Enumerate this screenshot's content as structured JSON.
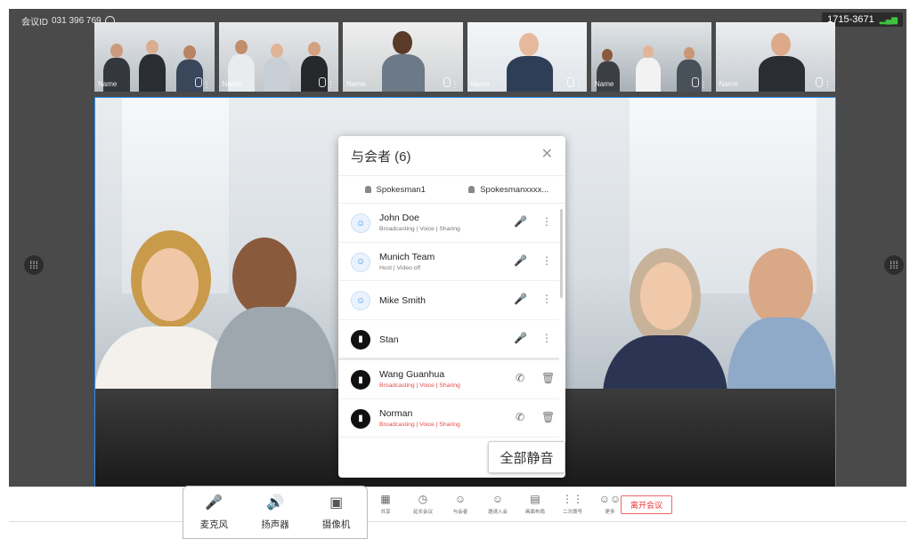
{
  "meeting": {
    "id_label": "会议ID",
    "id_value": "031 396 769",
    "room_code": "1715-3671",
    "signal_icon": "signal-icon"
  },
  "thumbnails": [
    {
      "name": "Name"
    },
    {
      "name": "Name"
    },
    {
      "name": "Name"
    },
    {
      "name": "Name"
    },
    {
      "name": "Name"
    },
    {
      "name": "Name"
    }
  ],
  "participants_panel": {
    "title": "与会者 (6)",
    "spokesmen": [
      "Spokesman1",
      "Spokesmanxxxx..."
    ],
    "participants": [
      {
        "name": "John Doe",
        "status": "Broadcasting | Voice | Sharing",
        "avatar": "person-icon"
      },
      {
        "name": "Munich Team",
        "status": "Host | Video off",
        "avatar": "person-icon"
      },
      {
        "name": "Mike Smith",
        "status": "",
        "avatar": "person-icon"
      },
      {
        "name": "Stan",
        "status": "",
        "avatar": "device-icon"
      },
      {
        "name": "Wang Guanhua",
        "status": "Broadcasting | Voice | Sharing",
        "avatar": "device-icon"
      },
      {
        "name": "Norman",
        "status": "Broadcasting | Voice | Sharing",
        "avatar": "device-icon"
      }
    ],
    "mute_all": "全部静音"
  },
  "toolbar": {
    "microphone": "麦克风",
    "speaker": "扬声器",
    "camera": "摄像机",
    "items": [
      "共享",
      "延长会议",
      "与会者",
      "邀请入会",
      "画面布局",
      "二次拨号",
      "更多"
    ],
    "leave": "离开会议"
  },
  "colors": {
    "accent": "#2a8ef1",
    "danger": "#e33333",
    "stage_bg": "#4a4a4a"
  }
}
